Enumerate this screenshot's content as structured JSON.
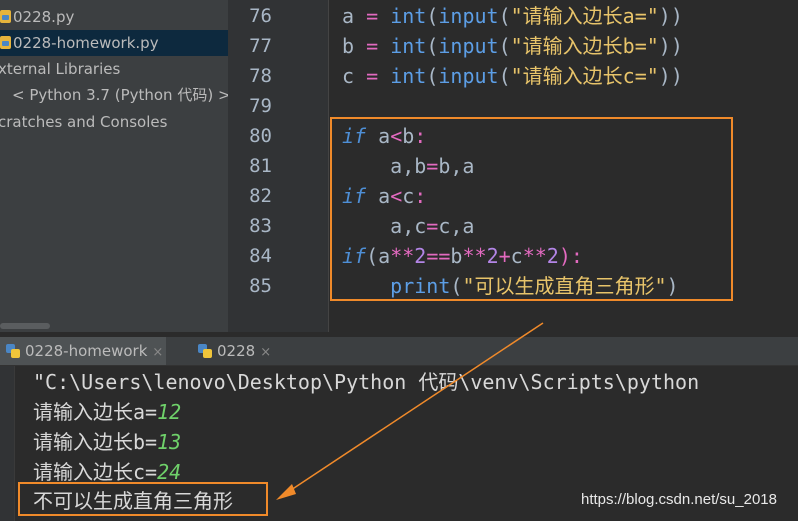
{
  "project_tree": {
    "items": [
      {
        "label": "0228.py",
        "type": "file",
        "selected": false
      },
      {
        "label": "0228-homework.py",
        "type": "file",
        "selected": true
      },
      {
        "label": "xternal Libraries",
        "type": "folder",
        "selected": false
      },
      {
        "label": "< Python 3.7 (Python 代码) >",
        "type": "sdk",
        "selected": false
      },
      {
        "label": "cratches and Consoles",
        "type": "folder",
        "selected": false
      }
    ]
  },
  "editor": {
    "line_numbers": [
      "76",
      "77",
      "78",
      "79",
      "80",
      "81",
      "82",
      "83",
      "84",
      "85"
    ],
    "lines": [
      [
        {
          "t": "a ",
          "c": "pl"
        },
        {
          "t": "=",
          "c": "op"
        },
        {
          "t": " ",
          "c": "pl"
        },
        {
          "t": "int",
          "c": "fn"
        },
        {
          "t": "(",
          "c": "pl"
        },
        {
          "t": "input",
          "c": "fn"
        },
        {
          "t": "(",
          "c": "pl"
        },
        {
          "t": "\"请输入边长a=\"",
          "c": "str"
        },
        {
          "t": "))",
          "c": "pl"
        }
      ],
      [
        {
          "t": "b ",
          "c": "pl"
        },
        {
          "t": "=",
          "c": "op"
        },
        {
          "t": " ",
          "c": "pl"
        },
        {
          "t": "int",
          "c": "fn"
        },
        {
          "t": "(",
          "c": "pl"
        },
        {
          "t": "input",
          "c": "fn"
        },
        {
          "t": "(",
          "c": "pl"
        },
        {
          "t": "\"请输入边长b=\"",
          "c": "str"
        },
        {
          "t": "))",
          "c": "pl"
        }
      ],
      [
        {
          "t": "c ",
          "c": "pl"
        },
        {
          "t": "=",
          "c": "op"
        },
        {
          "t": " ",
          "c": "pl"
        },
        {
          "t": "int",
          "c": "fn"
        },
        {
          "t": "(",
          "c": "pl"
        },
        {
          "t": "input",
          "c": "fn"
        },
        {
          "t": "(",
          "c": "pl"
        },
        {
          "t": "\"请输入边长c=\"",
          "c": "str"
        },
        {
          "t": "))",
          "c": "pl"
        }
      ],
      [],
      [
        {
          "t": "if",
          "c": "kw"
        },
        {
          "t": " a",
          "c": "pl"
        },
        {
          "t": "<",
          "c": "op"
        },
        {
          "t": "b",
          "c": "pl"
        },
        {
          "t": ":",
          "c": "op"
        }
      ],
      [
        {
          "t": "    a,b",
          "c": "pl"
        },
        {
          "t": "=",
          "c": "op"
        },
        {
          "t": "b,a",
          "c": "pl"
        }
      ],
      [
        {
          "t": "if",
          "c": "kw"
        },
        {
          "t": " a",
          "c": "pl"
        },
        {
          "t": "<",
          "c": "op"
        },
        {
          "t": "c",
          "c": "pl"
        },
        {
          "t": ":",
          "c": "op"
        }
      ],
      [
        {
          "t": "    a,c",
          "c": "pl"
        },
        {
          "t": "=",
          "c": "op"
        },
        {
          "t": "c,a",
          "c": "pl"
        }
      ],
      [
        {
          "t": "if",
          "c": "kw"
        },
        {
          "t": "(a",
          "c": "pl"
        },
        {
          "t": "**",
          "c": "op"
        },
        {
          "t": "2",
          "c": "num"
        },
        {
          "t": "==",
          "c": "op"
        },
        {
          "t": "b",
          "c": "pl"
        },
        {
          "t": "**",
          "c": "op"
        },
        {
          "t": "2",
          "c": "num"
        },
        {
          "t": "+",
          "c": "op"
        },
        {
          "t": "c",
          "c": "pl"
        },
        {
          "t": "**",
          "c": "op"
        },
        {
          "t": "2",
          "c": "num"
        },
        {
          "t": "):",
          "c": "op"
        }
      ],
      [
        {
          "t": "    ",
          "c": "pl"
        },
        {
          "t": "print",
          "c": "fn"
        },
        {
          "t": "(",
          "c": "pl"
        },
        {
          "t": "\"可以生成直角三角形\"",
          "c": "str"
        },
        {
          "t": ")",
          "c": "pl"
        }
      ]
    ]
  },
  "run_tabs": [
    {
      "label": "0228-homework",
      "active": true
    },
    {
      "label": "0228",
      "active": false
    }
  ],
  "tab_close_glyph": "×",
  "console": {
    "command": "\"C:\\Users\\lenovo\\Desktop\\Python 代码\\venv\\Scripts\\python",
    "lines": [
      {
        "prompt": "请输入边长a=",
        "input": "12"
      },
      {
        "prompt": "请输入边长b=",
        "input": "13"
      },
      {
        "prompt": "请输入边长c=",
        "input": "24"
      }
    ],
    "result": "不可以生成直角三角形"
  },
  "watermark": "https://blog.csdn.net/su_2018",
  "colors": {
    "annotation_orange": "#f08a2a",
    "keyword": "#4e8fd6",
    "string": "#e8c46a",
    "operator": "#e36ac0",
    "number": "#b385e6",
    "user_input": "#6fd16a"
  }
}
